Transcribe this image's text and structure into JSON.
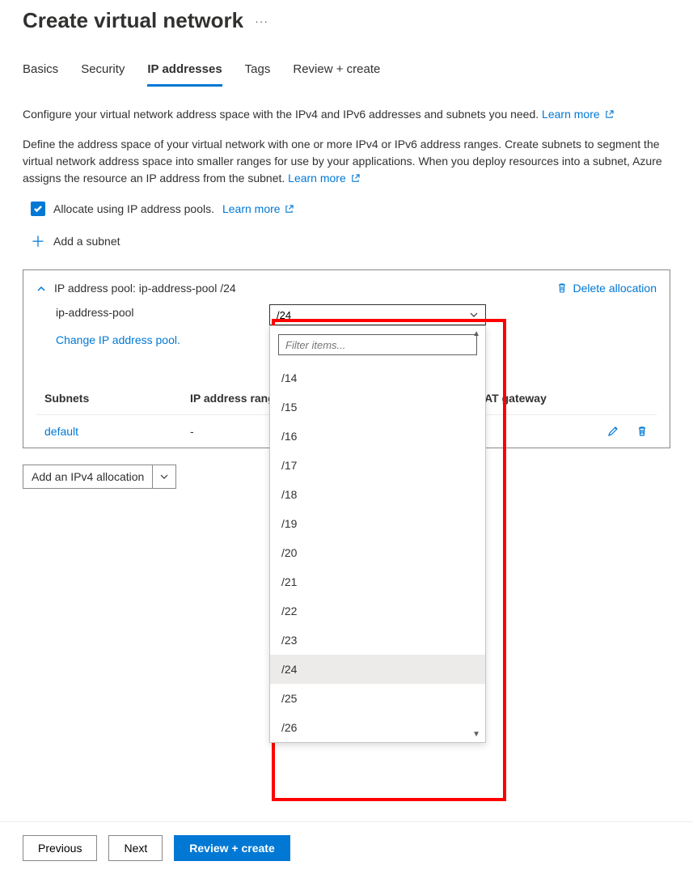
{
  "header": {
    "title": "Create virtual network"
  },
  "tabs": [
    {
      "label": "Basics",
      "active": false
    },
    {
      "label": "Security",
      "active": false
    },
    {
      "label": "IP addresses",
      "active": true
    },
    {
      "label": "Tags",
      "active": false
    },
    {
      "label": "Review + create",
      "active": false
    }
  ],
  "intro": {
    "line1": "Configure your virtual network address space with the IPv4 and IPv6 addresses and subnets you need.",
    "learn_more1": "Learn more",
    "line2": "Define the address space of your virtual network with one or more IPv4 or IPv6 address ranges. Create subnets to segment the virtual network address space into smaller ranges for use by your applications. When you deploy resources into a subnet, Azure assigns the resource an IP address from the subnet.",
    "learn_more2": "Learn more"
  },
  "options": {
    "allocate_label": "Allocate using IP address pools.",
    "allocate_learn_more": "Learn more",
    "add_subnet": "Add a subnet"
  },
  "pool": {
    "title": "IP address pool: ip-address-pool /24",
    "delete_label": "Delete allocation",
    "name": "ip-address-pool",
    "selected_cidr": "/24",
    "change_link": "Change IP address pool."
  },
  "dropdown": {
    "filter_placeholder": "Filter items...",
    "items": [
      "/14",
      "/15",
      "/16",
      "/17",
      "/18",
      "/19",
      "/20",
      "/21",
      "/22",
      "/23",
      "/24",
      "/25",
      "/26"
    ],
    "selected": "/24"
  },
  "subnets": {
    "col1": "Subnets",
    "col2": "IP address range",
    "col3": "NAT gateway",
    "rows": [
      {
        "name": "default",
        "range": "-",
        "nat": ""
      }
    ]
  },
  "add_allocation": "Add an IPv4 allocation",
  "footer": {
    "previous": "Previous",
    "next": "Next",
    "review": "Review + create"
  }
}
